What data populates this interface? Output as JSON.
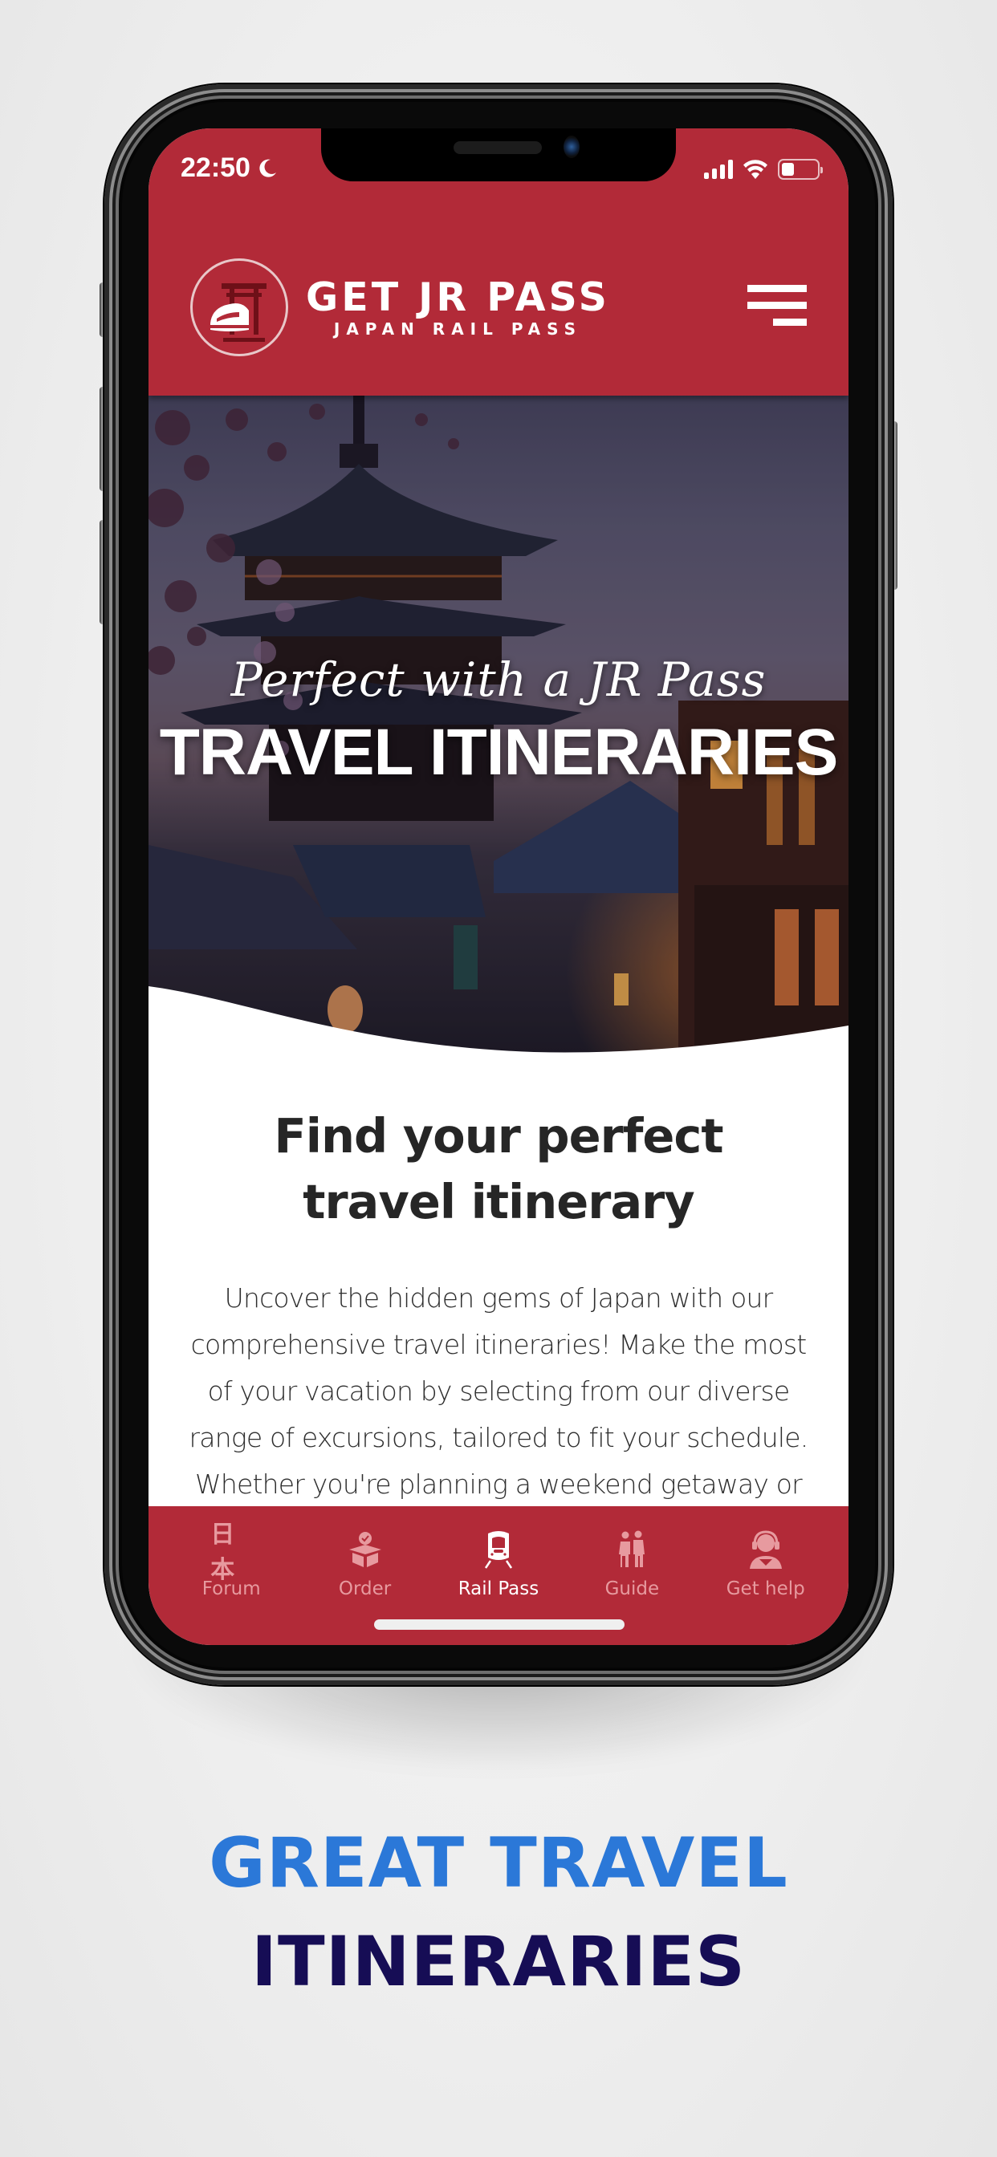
{
  "status_bar": {
    "time": "22:50",
    "focus_icon": "moon-icon",
    "signal_icon": "cellular-signal-icon",
    "wifi_icon": "wifi-icon",
    "battery_icon": "battery-icon",
    "battery_level": 0.35
  },
  "header": {
    "logo_title": "GET JR PASS",
    "logo_subtitle": "JAPAN RAIL PASS",
    "logo_icon": "torii-train-logo-icon",
    "menu_icon": "hamburger-menu-icon"
  },
  "hero": {
    "script_line": "Perfect with a JR Pass",
    "title": "TRAVEL ITINERARIES"
  },
  "content": {
    "heading": "Find your perfect travel itinerary",
    "body": "Uncover the hidden gems of Japan with our comprehensive travel itineraries! Make the most of your vacation by selecting from our diverse range of excursions, tailored to fit your schedule. Whether you're planning a weekend getaway or an extended"
  },
  "tab_bar": {
    "active_index": 2,
    "tabs": [
      {
        "label": "Forum",
        "icon": "japanese-characters-icon",
        "glyph": "日本"
      },
      {
        "label": "Order",
        "icon": "box-check-icon"
      },
      {
        "label": "Rail Pass",
        "icon": "train-icon"
      },
      {
        "label": "Guide",
        "icon": "travelers-icon"
      },
      {
        "label": "Get help",
        "icon": "support-agent-icon"
      }
    ]
  },
  "caption": {
    "line1": "GREAT TRAVEL",
    "line2": "ITINERARIES"
  },
  "colors": {
    "brand_red": "#b22a38",
    "tab_inactive": "#e79a9f",
    "caption_blue": "#2b78d8",
    "caption_navy": "#160d55",
    "heading_text": "#262626"
  }
}
